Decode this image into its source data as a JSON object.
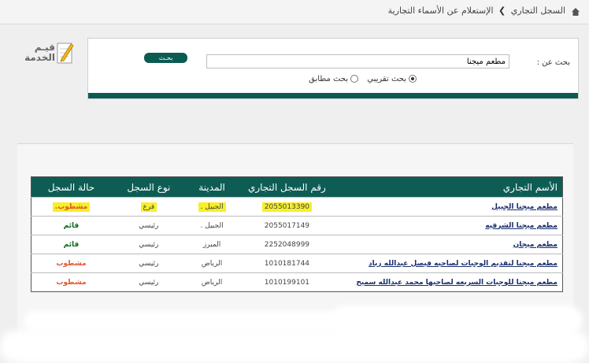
{
  "breadcrumb": {
    "root": "السجل التجاري",
    "separator": "❯",
    "current": "الإستعلام عن الأسماء التجارية"
  },
  "logo": {
    "line1": "قيـم",
    "line2": "الخدمة"
  },
  "search": {
    "label": "بحث عن :",
    "value": "مطعم ميجنا",
    "button_label": "بحـث",
    "options": [
      {
        "label": "بحث تقريبي",
        "selected": true
      },
      {
        "label": "بحث مطابق",
        "selected": false
      }
    ]
  },
  "table": {
    "headers": [
      "الأسم التجاري",
      "رقم السجل التجاري",
      "المدينة",
      "نوع السجل",
      "حالة السجل"
    ],
    "rows": [
      {
        "name": "مطعم ميجنا الجبيل",
        "number": "2055013390",
        "city": "الجبيل .",
        "type": "فرع",
        "status": "مشطوب.",
        "status_color": "red",
        "highlight": true
      },
      {
        "name": "مطعم ميجنا الشرقيه",
        "number": "2055017149",
        "city": "الجبيل .",
        "type": "رئيسي",
        "status": "قائم",
        "status_color": "green",
        "highlight": false
      },
      {
        "name": "مطعم ميجان",
        "number": "2252048999",
        "city": "المبرز",
        "type": "رئيسي",
        "status": "قائم",
        "status_color": "green",
        "highlight": false
      },
      {
        "name": "مطعم ميجنا لتقديم الوجبات لصاحبه فيصل عبدالله زياد",
        "number": "1010181744",
        "city": "الرياض",
        "type": "رئيسي",
        "status": "مشطوب",
        "status_color": "red",
        "highlight": false
      },
      {
        "name": "مطعم ميجنا للوجبات السريعه لصاحبها محمد عبدالله سميح",
        "number": "1010199101",
        "city": "الرياض",
        "type": "رئيسي",
        "status": "مشطوب",
        "status_color": "red",
        "highlight": false
      }
    ]
  },
  "colors": {
    "accent": "#0c5b52",
    "status_active": "#0b6a20",
    "status_struck": "#e2562c",
    "highlight": "#f7ef2a"
  }
}
